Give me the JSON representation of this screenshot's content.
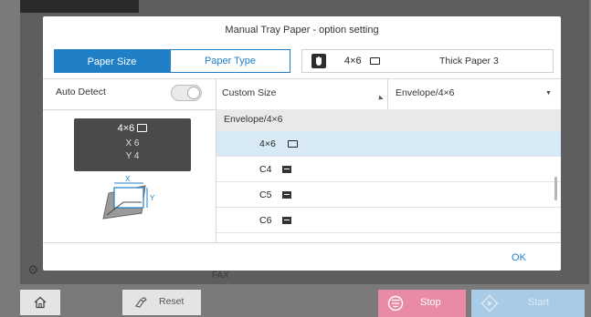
{
  "dialog": {
    "title": "Manual Tray Paper - option setting",
    "ok_label": "OK"
  },
  "tabs": [
    {
      "label": "Paper Size",
      "active": true
    },
    {
      "label": "Paper Type",
      "active": false
    }
  ],
  "tray": {
    "size_text": "4×6",
    "paper_type": "Thick Paper 3",
    "icon": "hand-tray-icon"
  },
  "auto_detect": {
    "label": "Auto Detect",
    "enabled": false
  },
  "selects": {
    "custom_size": "Custom Size",
    "envelope": "Envelope/4×6"
  },
  "preview": {
    "size": "4×6",
    "x": "X  6",
    "y": "Y  4",
    "diagram_x_label": "X",
    "diagram_y_label": "Y"
  },
  "list": {
    "group_header": "Envelope/4×6",
    "items": [
      {
        "label": "4×6",
        "icon": "card-icon",
        "selected": true
      },
      {
        "label": "C4",
        "icon": "envelope-icon",
        "selected": false
      },
      {
        "label": "C5",
        "icon": "envelope-icon",
        "selected": false
      },
      {
        "label": "C6",
        "icon": "envelope-icon",
        "selected": false
      }
    ]
  },
  "bottom_bar": {
    "reset_label": "Reset",
    "stop_label": "Stop",
    "start_label": "Start"
  },
  "background": {
    "fax_label": "FAX"
  },
  "colors": {
    "accent": "#1f80c8",
    "selected_row": "#d8eaf6",
    "stop": "#e98aa6",
    "start": "#a9cbe6"
  }
}
